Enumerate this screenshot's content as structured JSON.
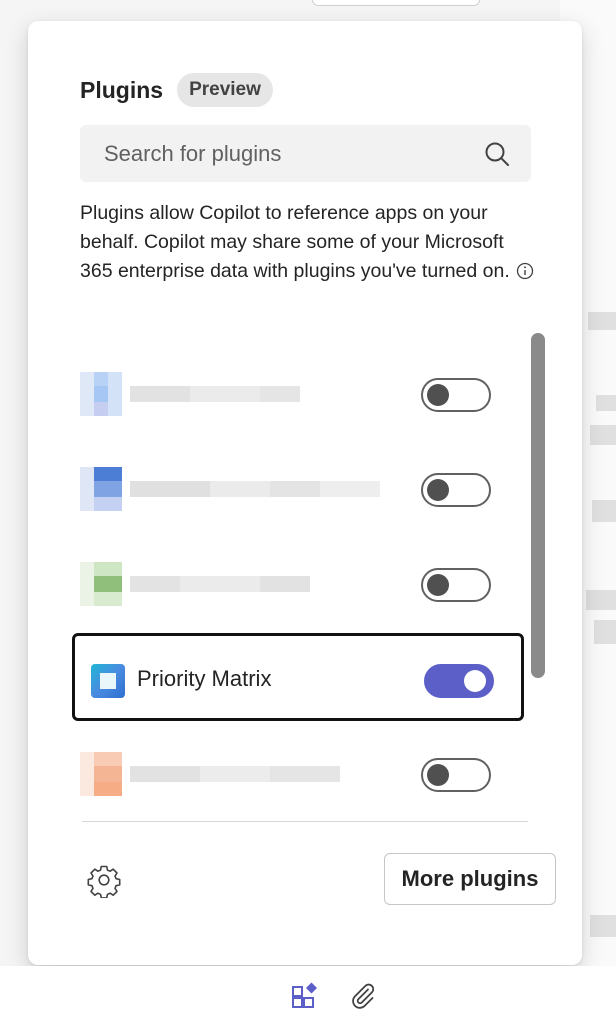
{
  "panel": {
    "title": "Plugins",
    "badge": "Preview"
  },
  "search": {
    "placeholder": "Search for plugins"
  },
  "description": "Plugins allow Copilot to reference apps on your behalf. Copilot may share some of your Microsoft 365 enterprise data with plugins you've turned on.",
  "plugins": [
    {
      "name": "",
      "enabled": false,
      "obscured": true
    },
    {
      "name": "",
      "enabled": false,
      "obscured": true
    },
    {
      "name": "",
      "enabled": false,
      "obscured": true
    },
    {
      "name": "Priority Matrix",
      "enabled": true,
      "obscured": false
    },
    {
      "name": "",
      "enabled": false,
      "obscured": true
    }
  ],
  "footer": {
    "more_plugins_label": "More plugins"
  },
  "colors": {
    "toggle_on": "#5b5fc7",
    "toggle_off_knob": "#505050",
    "selected_border": "#111111"
  },
  "icons": {
    "search": "search-icon",
    "info": "info-icon",
    "settings": "gear-icon",
    "apps": "apps-icon",
    "attach": "paperclip-icon"
  }
}
